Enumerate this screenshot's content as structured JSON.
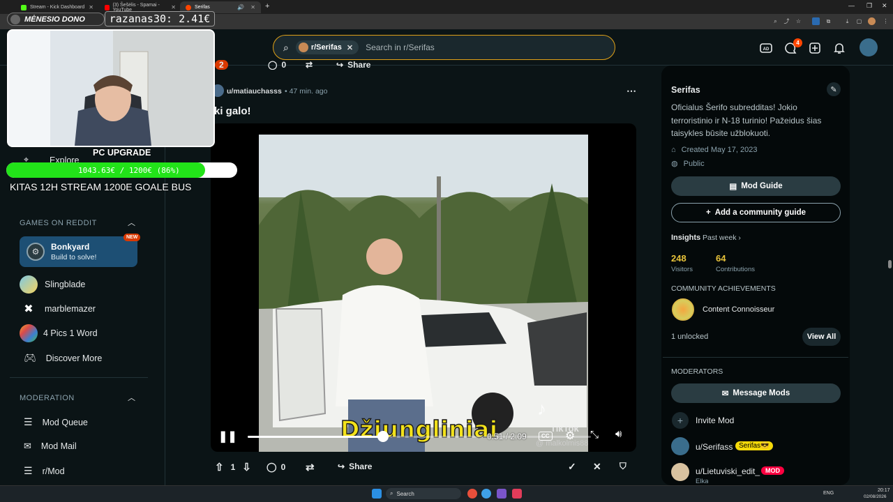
{
  "browser": {
    "tabs": [
      {
        "title": "Stream - Kick Dashboard",
        "color": "#53fc18"
      },
      {
        "title": "(3) Šešėlis - Spamai - YouTube",
        "color": "#ff0000"
      },
      {
        "title": "Serifas",
        "color": "#ff4500"
      }
    ],
    "new_tab": "+"
  },
  "header": {
    "community_chip": "r/Serifas",
    "search_placeholder": "Search in r/Serifas",
    "chat_badge": "4"
  },
  "stream_overlay": {
    "monthly_label": "MĖNESIO DONO",
    "top_donor": "razanas30: 2.41€",
    "goal_title": "PC UPGRADE",
    "goal_text": "1043.63€ / 1200€ (86%)",
    "goal_fraction": 0.86,
    "goal_subtext": "KITAS 12H STREAM 1200E GOALE BUS"
  },
  "left_sidebar": {
    "explore_label": "Explore",
    "games_heading": "GAMES ON REDDIT",
    "featured_game": {
      "name": "Bonkyard",
      "subtitle": "Build to solve!",
      "tag": "NEW"
    },
    "games": [
      {
        "name": "Slingblade",
        "icon": "slingblade-icon"
      },
      {
        "name": "marblemazer",
        "icon": "marblemazer-icon"
      },
      {
        "name": "4 Pics 1 Word",
        "icon": "four-pics-icon"
      },
      {
        "name": "Discover More",
        "icon": "gamepad-icon"
      }
    ],
    "moderation_heading": "MODERATION",
    "moderation": [
      {
        "name": "Mod Queue",
        "icon": "queue-icon"
      },
      {
        "name": "Mod Mail",
        "icon": "mail-icon"
      },
      {
        "name": "r/Mod",
        "icon": "queue-icon"
      }
    ]
  },
  "post": {
    "top_vote": "2",
    "top_comments": "0",
    "top_share": "Share",
    "author": "u/matiauchasss",
    "time": "47 min. ago",
    "title": "ki galo!",
    "video_caption": "Džiungliniai",
    "video_watermark": "TikTok",
    "video_handle": "@ malkolmis88",
    "time_display": "0:51 / 2:09",
    "progress_fraction": 0.395,
    "votes": "1",
    "comments": "0",
    "share": "Share"
  },
  "right_sidebar": {
    "name": "Serifas",
    "description": "Oficialus Šerifo subredditas! Jokio terroristinio ir N-18 turinio! Pažeidus šias taisykles būsite užblokuoti.",
    "created": "Created May 17, 2023",
    "visibility": "Public",
    "mod_guide": "Mod Guide",
    "add_guide": "Add a community guide",
    "insights_label": "Insights",
    "insights_range": "Past week",
    "visitors_value": "248",
    "visitors_label": "Visitors",
    "contrib_value": "64",
    "contrib_label": "Contributions",
    "achievements_heading": "COMMUNITY ACHIEVEMENTS",
    "achievement": "Content Connoisseur",
    "unlocked": "1 unlocked",
    "view_all": "View All",
    "moderators_heading": "MODERATORS",
    "message_mods": "Message Mods",
    "invite_mod": "Invite Mod",
    "mods": [
      {
        "name": "u/Serifass",
        "flair": "Serifas😎",
        "flair_color": "#f5d90a",
        "sub": ""
      },
      {
        "name": "u/Lietuviski_edit_",
        "flair": "MOD",
        "flair_color": "#ff0040",
        "sub": "Elka"
      }
    ]
  },
  "taskbar": {
    "search_label": "Search",
    "lang": "ENG",
    "time": "20:17",
    "date": "02/08/2026"
  },
  "colors": {
    "accent": "#ff4500",
    "search_border": "#e0a117",
    "goal_fill": "#22e319"
  }
}
